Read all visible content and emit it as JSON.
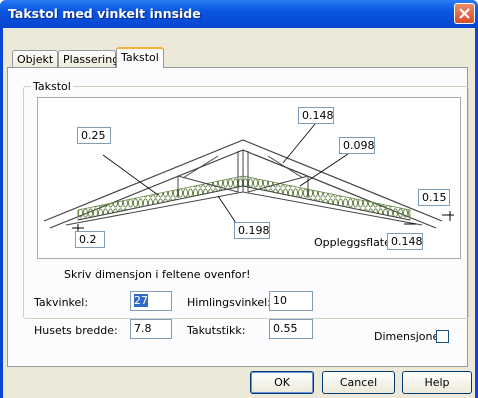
{
  "window": {
    "title": "Takstol med vinkelt innside",
    "close_icon": "close-icon"
  },
  "tabs": [
    {
      "label": "Objekt"
    },
    {
      "label": "Plassering"
    },
    {
      "label": "Takstol"
    }
  ],
  "group": {
    "label": "Takstol"
  },
  "dimensions": {
    "ridge_height": "0.148",
    "left_rafter": "0.25",
    "right_rafter": "0.098",
    "right_overhang": "0.15",
    "left_bottom": "0.2",
    "ceiling": "0.198",
    "bearing_label": "Oppleggsflate",
    "bearing_value": "0.148"
  },
  "form": {
    "instruction": "Skriv dimensjon i feltene ovenfor!",
    "takvinkel_label": "Takvinkel:",
    "takvinkel_value": "27",
    "himlingsvinkel_label": "Himlingsvinkel::",
    "himlingsvinkel_value": "10",
    "husets_bredde_label": "Husets bredde:",
    "husets_bredde_value": "7.8",
    "takutstikk_label": "Takutstikk:",
    "takutstikk_value": "0.55",
    "dimensjoner_label": "Dimensjoner",
    "dimensjoner_checked": false
  },
  "buttons": {
    "ok": "OK",
    "cancel": "Cancel",
    "help": "Help"
  }
}
